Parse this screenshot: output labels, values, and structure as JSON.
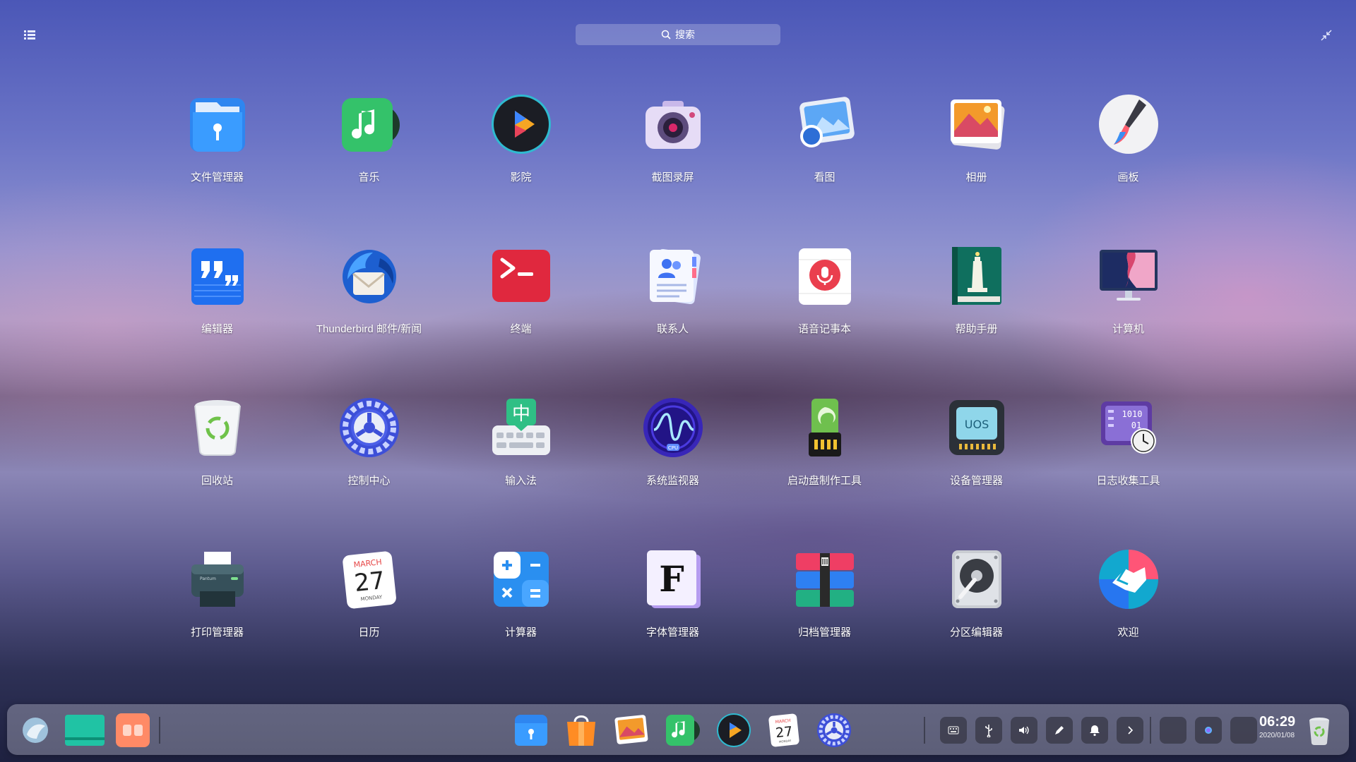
{
  "search": {
    "placeholder": "搜索"
  },
  "apps": [
    {
      "label": "文件管理器",
      "icon": "folder-icon"
    },
    {
      "label": "音乐",
      "icon": "music-icon"
    },
    {
      "label": "影院",
      "icon": "movie-player-icon"
    },
    {
      "label": "截图录屏",
      "icon": "camera-icon"
    },
    {
      "label": "看图",
      "icon": "image-viewer-icon"
    },
    {
      "label": "相册",
      "icon": "photo-album-icon"
    },
    {
      "label": "画板",
      "icon": "paint-brush-icon"
    },
    {
      "label": "编辑器",
      "icon": "text-editor-icon"
    },
    {
      "label": "Thunderbird 邮件/新闻",
      "icon": "thunderbird-icon"
    },
    {
      "label": "终端",
      "icon": "terminal-icon"
    },
    {
      "label": "联系人",
      "icon": "contacts-icon"
    },
    {
      "label": "语音记事本",
      "icon": "voice-note-icon"
    },
    {
      "label": "帮助手册",
      "icon": "help-manual-icon"
    },
    {
      "label": "计算机",
      "icon": "computer-icon"
    },
    {
      "label": "回收站",
      "icon": "trash-icon"
    },
    {
      "label": "控制中心",
      "icon": "settings-gear-icon"
    },
    {
      "label": "输入法",
      "icon": "keyboard-icon"
    },
    {
      "label": "系统监视器",
      "icon": "system-monitor-icon"
    },
    {
      "label": "启动盘制作工具",
      "icon": "boot-maker-icon"
    },
    {
      "label": "设备管理器",
      "icon": "device-manager-icon"
    },
    {
      "label": "日志收集工具",
      "icon": "log-viewer-icon"
    },
    {
      "label": "打印管理器",
      "icon": "printer-icon"
    },
    {
      "label": "日历",
      "icon": "calendar-icon"
    },
    {
      "label": "计算器",
      "icon": "calculator-icon"
    },
    {
      "label": "字体管理器",
      "icon": "font-manager-icon"
    },
    {
      "label": "归档管理器",
      "icon": "archive-manager-icon"
    },
    {
      "label": "分区编辑器",
      "icon": "disk-partition-icon"
    },
    {
      "label": "欢迎",
      "icon": "welcome-icon"
    }
  ],
  "icon_text": {
    "calendar_month": "MARCH",
    "calendar_day": "27",
    "calendar_weekday": "MONDAY",
    "monitor_cpu": "CPU",
    "device_uos": "UOS",
    "font_letter": "F",
    "log_digits_1": "1010",
    "log_digits_2": "01",
    "printer_brand": "Pantum",
    "input_method_char": "中"
  },
  "dock": {
    "left_items": [
      "launcher-icon",
      "workspace-icon",
      "multitask-icon"
    ],
    "pinned": [
      "folder-icon",
      "app-store-icon",
      "photo-album-icon",
      "music-icon",
      "movie-player-icon",
      "calendar-icon",
      "settings-gear-icon"
    ],
    "tray": [
      "keyboard-tray-icon",
      "usb-icon",
      "volume-icon",
      "pen-icon",
      "notification-bell-icon",
      "chevron-right-icon"
    ],
    "clock_time": "06:29",
    "clock_date": "2020/01/08"
  }
}
